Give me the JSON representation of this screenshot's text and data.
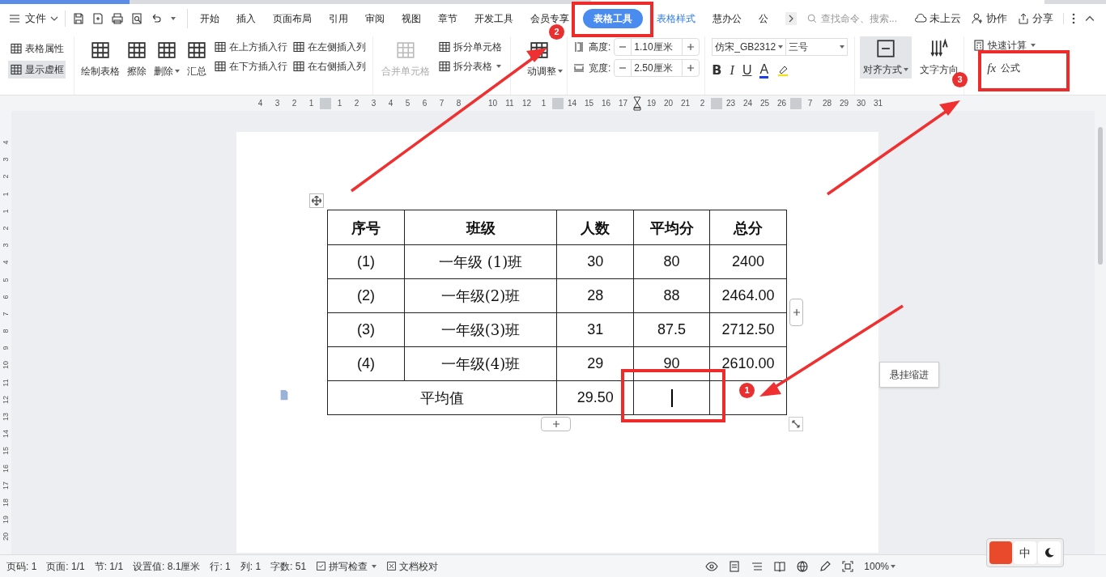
{
  "menu_bar": {
    "file_menu": "文件",
    "tabs": [
      {
        "label": "开始",
        "selected": false,
        "kind": "normal"
      },
      {
        "label": "插入",
        "selected": false,
        "kind": "normal"
      },
      {
        "label": "页面布局",
        "selected": false,
        "kind": "normal"
      },
      {
        "label": "引用",
        "selected": false,
        "kind": "normal"
      },
      {
        "label": "审阅",
        "selected": false,
        "kind": "normal"
      },
      {
        "label": "视图",
        "selected": false,
        "kind": "normal"
      },
      {
        "label": "章节",
        "selected": false,
        "kind": "normal"
      },
      {
        "label": "开发工具",
        "selected": false,
        "kind": "normal"
      },
      {
        "label": "会员专享",
        "selected": false,
        "kind": "normal"
      },
      {
        "label": "表格工具",
        "selected": true,
        "kind": "context"
      },
      {
        "label": "表格样式",
        "selected": false,
        "kind": "context"
      },
      {
        "label": "慧办公",
        "selected": false,
        "kind": "normal"
      },
      {
        "label": "公",
        "selected": false,
        "kind": "normal"
      }
    ],
    "search": {
      "placeholder": "查找命令、搜索..."
    },
    "actions": [
      "未上云",
      "协作",
      "分享"
    ]
  },
  "ribbon": {
    "view_options": [
      {
        "label": "表格属性",
        "selected": false
      },
      {
        "label": "显示虚框",
        "selected": true
      }
    ],
    "edit_tools": [
      {
        "label": "绘制表格",
        "dropdown": false
      },
      {
        "label": "擦除",
        "dropdown": false
      },
      {
        "label": "删除",
        "dropdown": true
      },
      {
        "label": "汇总",
        "dropdown": false
      }
    ],
    "insert_rows": [
      "在上方插入行",
      "在下方插入行"
    ],
    "insert_columns": [
      "在左侧插入列",
      "在右侧插入列"
    ],
    "merge": {
      "label": "合并单元格",
      "disabled": true
    },
    "split": [
      {
        "label": "拆分单元格",
        "dropdown": false
      },
      {
        "label": "拆分表格",
        "dropdown": true
      }
    ],
    "autofit": "动调整",
    "size": [
      {
        "label": "高度:",
        "value": "1.10厘米"
      },
      {
        "label": "宽度:",
        "value": "2.50厘米"
      }
    ],
    "font": {
      "family": "仿宋_GB2312",
      "size": "三号"
    },
    "format_buttons": [
      "B",
      "I",
      "U",
      "A"
    ],
    "align": {
      "label": "对齐方式",
      "selected": true
    },
    "text_direction": "文字方向",
    "quick_calc": "快速计算",
    "formula_icon": "fx",
    "formula": "公式"
  },
  "ruler": [
    {
      "kind": "num",
      "text": "4"
    },
    {
      "kind": "num",
      "text": "3"
    },
    {
      "kind": "num",
      "text": "2"
    },
    {
      "kind": "num",
      "text": "1"
    },
    {
      "kind": "marker"
    },
    {
      "kind": "num",
      "text": "1"
    },
    {
      "kind": "num",
      "text": "2"
    },
    {
      "kind": "num",
      "text": "3"
    },
    {
      "kind": "num",
      "text": "4"
    },
    {
      "kind": "num",
      "text": "5"
    },
    {
      "kind": "num",
      "text": "6"
    },
    {
      "kind": "num",
      "text": "7"
    },
    {
      "kind": "num",
      "text": "8"
    },
    {
      "kind": "covered"
    },
    {
      "kind": "num",
      "text": "10"
    },
    {
      "kind": "num",
      "text": "11"
    },
    {
      "kind": "num",
      "text": "12"
    },
    {
      "kind": "num",
      "text": "1"
    },
    {
      "kind": "marker"
    },
    {
      "kind": "num",
      "text": "14"
    },
    {
      "kind": "num",
      "text": "15"
    },
    {
      "kind": "num",
      "text": "16"
    },
    {
      "kind": "num",
      "text": "17"
    },
    {
      "kind": "indent"
    },
    {
      "kind": "num",
      "text": "19"
    },
    {
      "kind": "num",
      "text": "20"
    },
    {
      "kind": "num",
      "text": "21"
    },
    {
      "kind": "num",
      "text": "2"
    },
    {
      "kind": "marker"
    },
    {
      "kind": "num",
      "text": "23"
    },
    {
      "kind": "num",
      "text": "24"
    },
    {
      "kind": "num",
      "text": "25"
    },
    {
      "kind": "num",
      "text": "26"
    },
    {
      "kind": "marker"
    },
    {
      "kind": "num",
      "text": "7"
    },
    {
      "kind": "num",
      "text": "28"
    },
    {
      "kind": "num",
      "text": "29"
    },
    {
      "kind": "num",
      "text": "30"
    },
    {
      "kind": "num",
      "text": "31"
    }
  ],
  "vertical_ruler": [
    "4",
    "3",
    "2",
    "1",
    "1",
    "2",
    "3",
    "4",
    "5",
    "6",
    "7",
    "8",
    "9",
    "10",
    "11",
    "12",
    "13",
    "14",
    "15",
    "16",
    "17",
    "18",
    "19",
    "20"
  ],
  "table": {
    "columns": [
      "序号",
      "班级",
      "人数",
      "平均分",
      "总分"
    ],
    "rows": [
      [
        "(1)",
        "一年级 (1)班",
        "30",
        "80",
        "2400"
      ],
      [
        "(2)",
        "一年级(2)班",
        "28",
        "88",
        "2464.00"
      ],
      [
        "(3)",
        "一年级(3)班",
        "31",
        "87.5",
        "2712.50"
      ],
      [
        "(4)",
        "一年级(4)班",
        "29",
        "90",
        "2610.00"
      ]
    ],
    "footer": {
      "label": "平均值",
      "count": "29.50"
    }
  },
  "tooltip": "悬挂缩进",
  "annotations": [
    {
      "number": "1"
    },
    {
      "number": "2"
    },
    {
      "number": "3"
    }
  ],
  "status_bar": {
    "items": [
      "页码: 1",
      "页面: 1/1",
      "节: 1/1",
      "设置值: 8.1厘米",
      "行: 1",
      "列: 1",
      "字数: 51"
    ],
    "spell_check": "拼写检查",
    "proofread": "文档校对",
    "zoom": "100%"
  },
  "ime": {
    "mode": "中"
  }
}
